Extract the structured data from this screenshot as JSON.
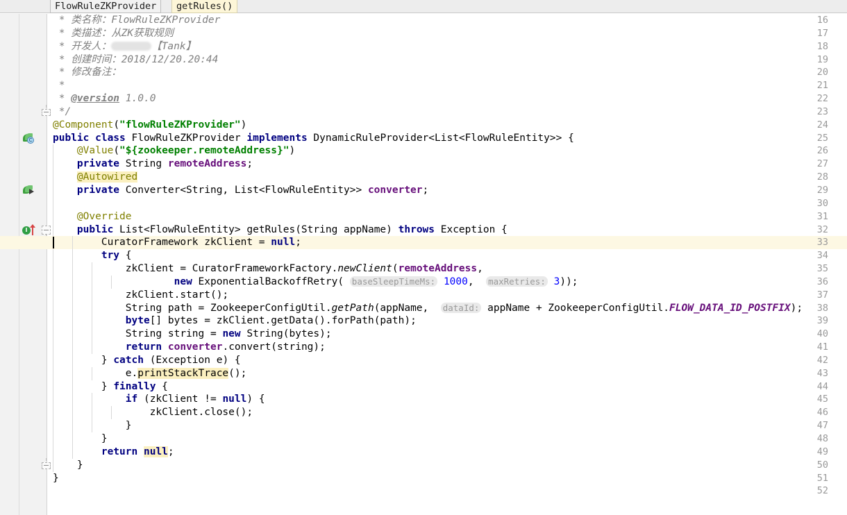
{
  "window": {
    "app": "IntelliJ IDEA",
    "editor_language": "Java",
    "file_name": "FlowRuleZKProvider.java"
  },
  "breadcrumb": {
    "items": [
      {
        "label": "FlowRuleZKProvider",
        "active": false
      },
      {
        "label": "getRules()",
        "active": true
      }
    ]
  },
  "colors": {
    "background": "#ffffff",
    "gutter_background": "#f2f2f2",
    "caret_line": "#fdf8e3",
    "search_highlight": "#fbf0c0",
    "keyword": "#000080",
    "string": "#008000",
    "comment": "#808080",
    "annotation": "#808000",
    "number": "#0000ff",
    "field": "#660e7a",
    "hint_background": "#e9e9e9",
    "hint_text": "#999999",
    "breadcrumb_active": "#fdf6d8"
  },
  "editor": {
    "caret": {
      "line": 33,
      "column": 0
    },
    "first_visible_line": 16,
    "last_visible_line": 52,
    "line_numbers": [
      16,
      17,
      18,
      19,
      20,
      21,
      22,
      23,
      24,
      25,
      26,
      27,
      28,
      29,
      30,
      31,
      32,
      33,
      34,
      35,
      36,
      37,
      38,
      39,
      40,
      41,
      42,
      43,
      44,
      45,
      46,
      47,
      48,
      49,
      50,
      51,
      52
    ],
    "gutter_markers": [
      {
        "line": 25,
        "icon": "spring-bean-icon",
        "tooltip": "Bean"
      },
      {
        "line": 29,
        "icon": "spring-autowired-icon",
        "tooltip": "Autowired dependency"
      },
      {
        "line": 32,
        "icon": "implementing-method-icon",
        "tooltip": "Implements method"
      }
    ],
    "fold_markers": [
      {
        "line": 23,
        "state": "expanded-end"
      },
      {
        "line": 32,
        "state": "expanded"
      },
      {
        "line": 50,
        "state": "expanded-end"
      }
    ],
    "code_lines": [
      {
        "n": 16,
        "text": " * 类名称：FlowRuleZKProvider"
      },
      {
        "n": 17,
        "text": " * 类描述：从ZK获取规则"
      },
      {
        "n": 18,
        "text": " * 开发人：[REDACTED]【Tank】"
      },
      {
        "n": 19,
        "text": " * 创建时间：2018/12/20.20:44"
      },
      {
        "n": 20,
        "text": " * 修改备注："
      },
      {
        "n": 21,
        "text": " *"
      },
      {
        "n": 22,
        "text": " * @version 1.0.0"
      },
      {
        "n": 23,
        "text": " */"
      },
      {
        "n": 24,
        "text": "@Component(\"flowRuleZKProvider\")"
      },
      {
        "n": 25,
        "text": "public class FlowRuleZKProvider implements DynamicRuleProvider<List<FlowRuleEntity>> {"
      },
      {
        "n": 26,
        "text": "    @Value(\"${zookeeper.remoteAddress}\")"
      },
      {
        "n": 27,
        "text": "    private String remoteAddress;"
      },
      {
        "n": 28,
        "text": "    @Autowired"
      },
      {
        "n": 29,
        "text": "    private Converter<String, List<FlowRuleEntity>> converter;"
      },
      {
        "n": 30,
        "text": ""
      },
      {
        "n": 31,
        "text": "    @Override"
      },
      {
        "n": 32,
        "text": "    public List<FlowRuleEntity> getRules(String appName) throws Exception {"
      },
      {
        "n": 33,
        "text": "        CuratorFramework zkClient = null;"
      },
      {
        "n": 34,
        "text": "        try {"
      },
      {
        "n": 35,
        "text": "            zkClient = CuratorFrameworkFactory.newClient(remoteAddress,"
      },
      {
        "n": 36,
        "text": "                    new ExponentialBackoffRetry( baseSleepTimeMs: 1000,  maxRetries: 3));"
      },
      {
        "n": 37,
        "text": "            zkClient.start();"
      },
      {
        "n": 38,
        "text": "            String path = ZookeeperConfigUtil.getPath(appName,  dataId: appName + ZookeeperConfigUtil.FLOW_DATA_ID_POSTFIX);"
      },
      {
        "n": 39,
        "text": "            byte[] bytes = zkClient.getData().forPath(path);"
      },
      {
        "n": 40,
        "text": "            String string = new String(bytes);"
      },
      {
        "n": 41,
        "text": "            return converter.convert(string);"
      },
      {
        "n": 42,
        "text": "        } catch (Exception e) {"
      },
      {
        "n": 43,
        "text": "            e.printStackTrace();"
      },
      {
        "n": 44,
        "text": "        } finally {"
      },
      {
        "n": 45,
        "text": "            if (zkClient != null) {"
      },
      {
        "n": 46,
        "text": "                zkClient.close();"
      },
      {
        "n": 47,
        "text": "            }"
      },
      {
        "n": 48,
        "text": "        }"
      },
      {
        "n": 49,
        "text": "        return null;"
      },
      {
        "n": 50,
        "text": "    }"
      },
      {
        "n": 51,
        "text": "}"
      },
      {
        "n": 52,
        "text": ""
      }
    ],
    "inline_hints": [
      {
        "line": 36,
        "label": "baseSleepTimeMs:",
        "value": "1000"
      },
      {
        "line": 36,
        "label": "maxRetries:",
        "value": "3"
      },
      {
        "line": 38,
        "label": "dataId:",
        "value": "appName + ZookeeperConfigUtil.FLOW_DATA_ID_POSTFIX"
      }
    ],
    "highlighted_occurrences": [
      {
        "line": 28,
        "text": "@Autowired"
      },
      {
        "line": 43,
        "text": "printStackTrace"
      },
      {
        "line": 49,
        "text": "null"
      }
    ]
  }
}
